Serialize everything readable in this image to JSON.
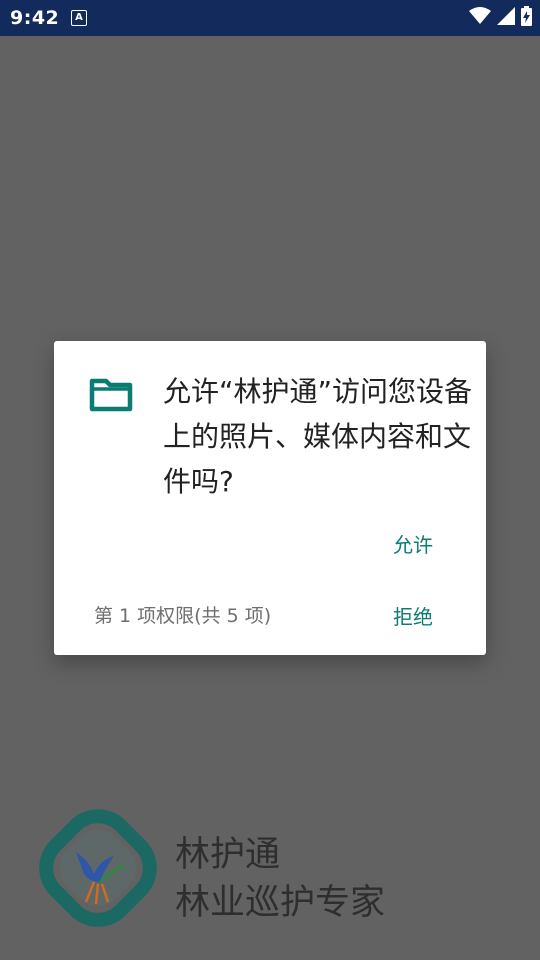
{
  "status_bar": {
    "time": "9:42",
    "notification_icon_text": "A",
    "icons": [
      "wifi-icon",
      "signal-icon",
      "battery-charging-icon"
    ]
  },
  "dialog": {
    "message": "允许“林护通”访问您设备上的照片、媒体内容和文件吗?",
    "allow_label": "允许",
    "deny_label": "拒绝",
    "counter": "第 1 项权限(共 5 项)",
    "icon": "folder-icon"
  },
  "background": {
    "app_name": "林护通",
    "tagline": "林业巡护专家"
  },
  "colors": {
    "status_bar": "#132a5c",
    "scrim": "#626262",
    "accent": "#0b7c74",
    "logo_teal": "#0f6b63"
  }
}
